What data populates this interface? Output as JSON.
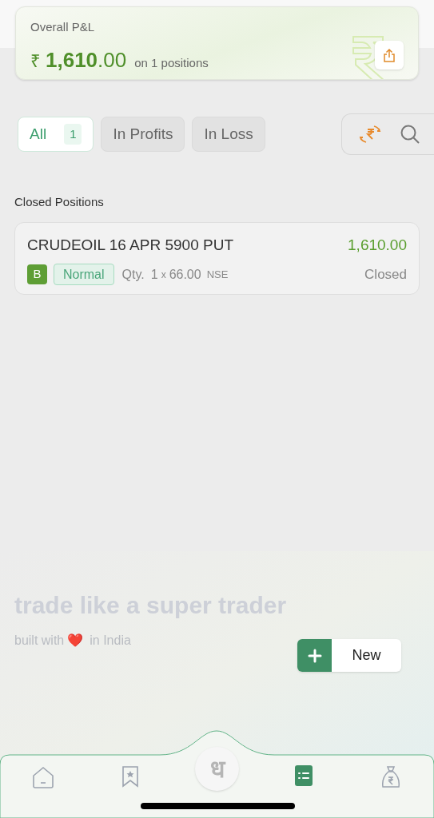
{
  "pnl": {
    "label": "Overall P&L",
    "currency": "₹",
    "amount_whole": "1,610",
    "amount_decimal": ".00",
    "positions_note": "on 1 positions"
  },
  "filters": [
    {
      "label": "All",
      "count": "1",
      "selected": true
    },
    {
      "label": "In Profits",
      "selected": false
    },
    {
      "label": "In Loss",
      "selected": false
    }
  ],
  "section_title": "Closed Positions",
  "positions": [
    {
      "symbol": "CRUDEOIL 16 APR 5900 PUT",
      "pnl": "1,610.00",
      "side": "B",
      "product": "Normal",
      "qty_label": "Qty.",
      "qty": "1",
      "times": "x",
      "price": "66.00",
      "exchange": "NSE",
      "status": "Closed"
    }
  ],
  "tagline": "trade like a super trader",
  "built_prefix": "built with",
  "built_emoji": "❤️",
  "built_suffix": "in India",
  "new_button": {
    "label": "New"
  },
  "logo": "ध",
  "nav": [
    {
      "kind": "home",
      "selected": false
    },
    {
      "kind": "watchlist",
      "selected": false
    },
    {
      "kind": "positions",
      "selected": true
    },
    {
      "kind": "funds",
      "selected": false
    }
  ]
}
